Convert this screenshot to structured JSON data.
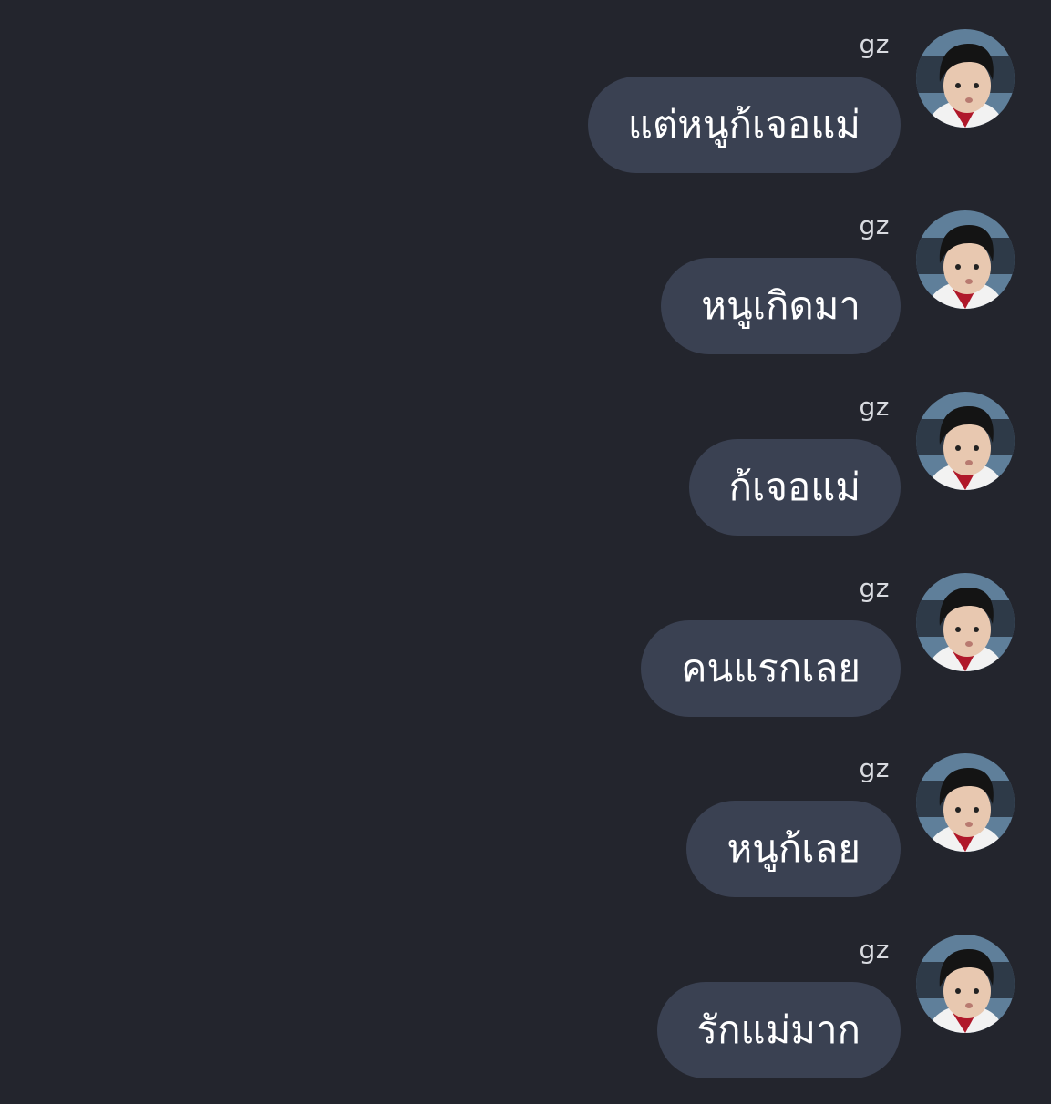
{
  "messages": [
    {
      "sender": "gz",
      "text": "แต่หนูก้เจอแม่",
      "avatar_icon": "child-portrait-avatar"
    },
    {
      "sender": "gz",
      "text": "หนูเกิดมา",
      "avatar_icon": "child-portrait-avatar"
    },
    {
      "sender": "gz",
      "text": "ก้เจอแม่",
      "avatar_icon": "child-portrait-avatar"
    },
    {
      "sender": "gz",
      "text": "คนแรกเลย",
      "avatar_icon": "child-portrait-avatar"
    },
    {
      "sender": "gz",
      "text": "หนูก้เลย",
      "avatar_icon": "child-portrait-avatar"
    },
    {
      "sender": "gz",
      "text": "รักแม่มาก",
      "avatar_icon": "child-portrait-avatar"
    }
  ],
  "colors": {
    "background": "#23252d",
    "bubble": "#3a4152",
    "bubble_text": "#ffffff",
    "sender_text": "#d9dbe0"
  }
}
